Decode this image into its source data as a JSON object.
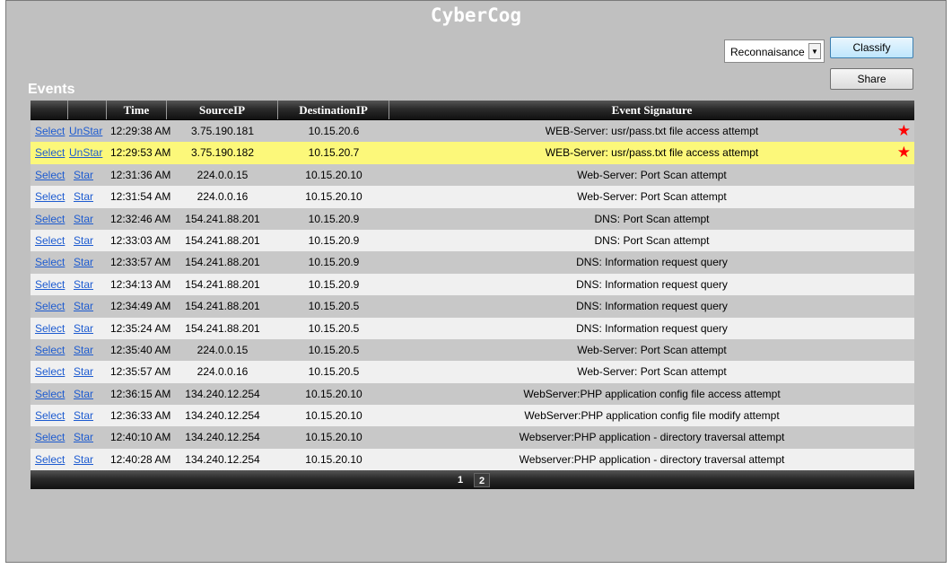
{
  "app": {
    "title": "CyberCog"
  },
  "toolbar": {
    "category_value": "Reconnaisance",
    "classify_label": "Classify",
    "share_label": "Share"
  },
  "events": {
    "title": "Events",
    "columns": [
      "",
      "",
      "Time",
      "SourceIP",
      "DestinationIP",
      "Event Signature"
    ],
    "rows": [
      {
        "select": "Select",
        "star_action": "UnStar",
        "time": "12:29:38 AM",
        "source": "3.75.190.181",
        "dest": "10.15.20.6",
        "signature": "WEB-Server: usr/pass.txt file access attempt",
        "starred": true,
        "highlighted": false
      },
      {
        "select": "Select",
        "star_action": "UnStar",
        "time": "12:29:53 AM",
        "source": "3.75.190.182",
        "dest": "10.15.20.7",
        "signature": "WEB-Server: usr/pass.txt file access attempt",
        "starred": true,
        "highlighted": true
      },
      {
        "select": "Select",
        "star_action": "Star",
        "time": "12:31:36 AM",
        "source": "224.0.0.15",
        "dest": "10.15.20.10",
        "signature": "Web-Server: Port Scan attempt",
        "starred": false,
        "highlighted": false
      },
      {
        "select": "Select",
        "star_action": "Star",
        "time": "12:31:54 AM",
        "source": "224.0.0.16",
        "dest": "10.15.20.10",
        "signature": "Web-Server: Port Scan attempt",
        "starred": false,
        "highlighted": false
      },
      {
        "select": "Select",
        "star_action": "Star",
        "time": "12:32:46 AM",
        "source": "154.241.88.201",
        "dest": "10.15.20.9",
        "signature": "DNS: Port Scan attempt",
        "starred": false,
        "highlighted": false
      },
      {
        "select": "Select",
        "star_action": "Star",
        "time": "12:33:03 AM",
        "source": "154.241.88.201",
        "dest": "10.15.20.9",
        "signature": "DNS: Port Scan attempt",
        "starred": false,
        "highlighted": false
      },
      {
        "select": "Select",
        "star_action": "Star",
        "time": "12:33:57 AM",
        "source": "154.241.88.201",
        "dest": "10.15.20.9",
        "signature": "DNS: Information request query",
        "starred": false,
        "highlighted": false
      },
      {
        "select": "Select",
        "star_action": "Star",
        "time": "12:34:13 AM",
        "source": "154.241.88.201",
        "dest": "10.15.20.9",
        "signature": "DNS: Information request query",
        "starred": false,
        "highlighted": false
      },
      {
        "select": "Select",
        "star_action": "Star",
        "time": "12:34:49 AM",
        "source": "154.241.88.201",
        "dest": "10.15.20.5",
        "signature": "DNS: Information request query",
        "starred": false,
        "highlighted": false
      },
      {
        "select": "Select",
        "star_action": "Star",
        "time": "12:35:24 AM",
        "source": "154.241.88.201",
        "dest": "10.15.20.5",
        "signature": "DNS: Information request query",
        "starred": false,
        "highlighted": false
      },
      {
        "select": "Select",
        "star_action": "Star",
        "time": "12:35:40 AM",
        "source": "224.0.0.15",
        "dest": "10.15.20.5",
        "signature": "Web-Server: Port Scan attempt",
        "starred": false,
        "highlighted": false
      },
      {
        "select": "Select",
        "star_action": "Star",
        "time": "12:35:57 AM",
        "source": "224.0.0.16",
        "dest": "10.15.20.5",
        "signature": "Web-Server: Port Scan attempt",
        "starred": false,
        "highlighted": false
      },
      {
        "select": "Select",
        "star_action": "Star",
        "time": "12:36:15 AM",
        "source": "134.240.12.254",
        "dest": "10.15.20.10",
        "signature": "WebServer:PHP application config file access attempt",
        "starred": false,
        "highlighted": false
      },
      {
        "select": "Select",
        "star_action": "Star",
        "time": "12:36:33 AM",
        "source": "134.240.12.254",
        "dest": "10.15.20.10",
        "signature": "WebServer:PHP application config file modify attempt",
        "starred": false,
        "highlighted": false
      },
      {
        "select": "Select",
        "star_action": "Star",
        "time": "12:40:10 AM",
        "source": "134.240.12.254",
        "dest": "10.15.20.10",
        "signature": "Webserver:PHP application - directory traversal attempt",
        "starred": false,
        "highlighted": false
      },
      {
        "select": "Select",
        "star_action": "Star",
        "time": "12:40:28 AM",
        "source": "134.240.12.254",
        "dest": "10.15.20.10",
        "signature": "Webserver:PHP application - directory traversal attempt",
        "starred": false,
        "highlighted": false
      }
    ]
  },
  "pagination": {
    "current": "1",
    "pages": [
      "1",
      "2"
    ]
  },
  "icons": {
    "star": "star-icon",
    "dropdown": "chevron-down-icon"
  },
  "colors": {
    "highlight_row": "#fcf87a",
    "star": "#ff0000",
    "link": "#1d5bd0"
  }
}
